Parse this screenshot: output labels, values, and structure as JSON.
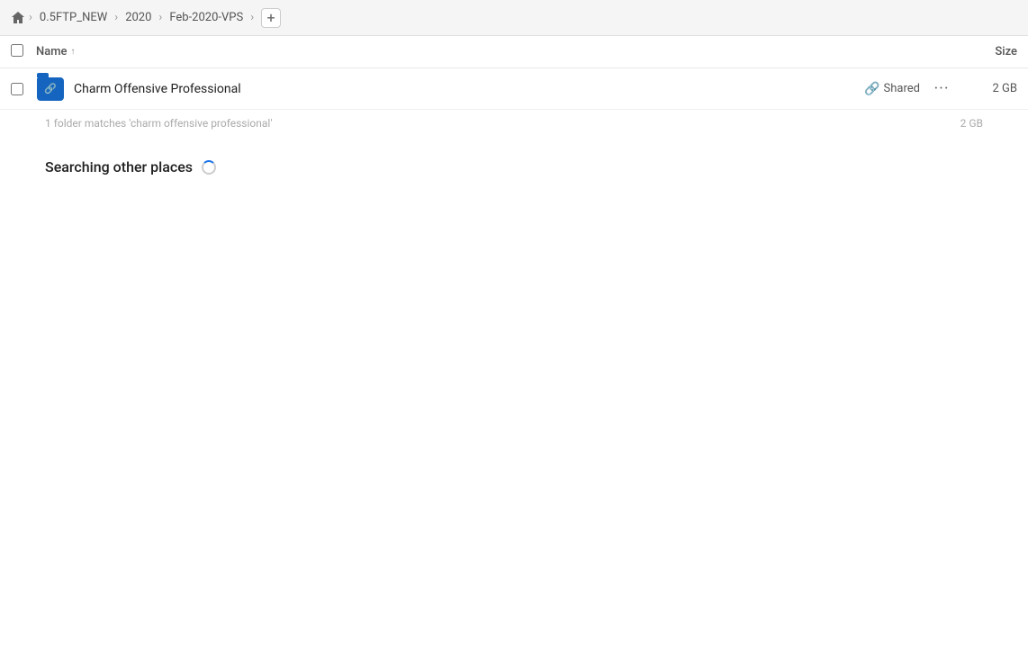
{
  "breadcrumb": {
    "home_label": "Home",
    "items": [
      {
        "label": "0.5FTP_NEW"
      },
      {
        "label": "2020"
      },
      {
        "label": "Feb-2020-VPS"
      }
    ],
    "add_label": "+"
  },
  "column_header": {
    "name_label": "Name",
    "name_sort_arrow": "↑",
    "size_label": "Size"
  },
  "files": [
    {
      "name": "Charm Offensive Professional",
      "shared_label": "Shared",
      "size": "2 GB",
      "type": "folder_shared"
    }
  ],
  "match_info": {
    "text": "1 folder matches 'charm offensive professional'",
    "size": "2 GB"
  },
  "searching_section": {
    "label": "Searching other places",
    "spinner": true
  }
}
